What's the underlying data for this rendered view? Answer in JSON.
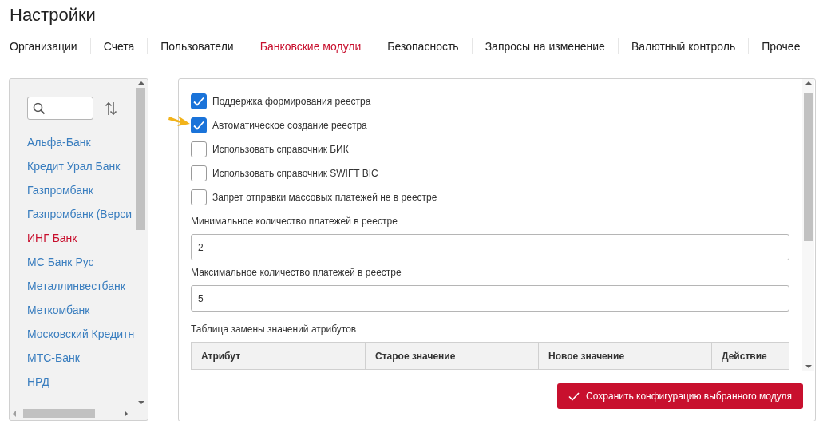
{
  "title": "Настройки",
  "tabs": [
    {
      "label": "Организации",
      "selected": false
    },
    {
      "label": "Счета",
      "selected": false
    },
    {
      "label": "Пользователи",
      "selected": false
    },
    {
      "label": "Банковские модули",
      "selected": true
    },
    {
      "label": "Безопасность",
      "selected": false
    },
    {
      "label": "Запросы на изменение",
      "selected": false
    },
    {
      "label": "Валютный контроль",
      "selected": false
    },
    {
      "label": "Прочее",
      "selected": false
    }
  ],
  "sidebar": {
    "items": [
      {
        "label": "Альфа-Банк",
        "selected": false
      },
      {
        "label": "Кредит Урал Банк",
        "selected": false
      },
      {
        "label": "Газпромбанк",
        "selected": false
      },
      {
        "label": "Газпромбанк (Верси",
        "selected": false
      },
      {
        "label": "ИНГ Банк",
        "selected": true
      },
      {
        "label": "МС Банк Рус",
        "selected": false
      },
      {
        "label": "Металлинвестбанк",
        "selected": false
      },
      {
        "label": "Меткомбанк",
        "selected": false
      },
      {
        "label": "Московский Кредитн",
        "selected": false
      },
      {
        "label": "МТС-Банк",
        "selected": false
      },
      {
        "label": "НРД",
        "selected": false
      }
    ]
  },
  "module": {
    "checkboxes": [
      {
        "label": "Поддержка формирования реестра",
        "checked": true
      },
      {
        "label": "Автоматическое создание реестра",
        "checked": true
      },
      {
        "label": "Использовать справочник БИК",
        "checked": false
      },
      {
        "label": "Использовать справочник SWIFT BIC",
        "checked": false
      },
      {
        "label": "Запрет отправки массовых платежей не в реестре",
        "checked": false
      }
    ],
    "fields": [
      {
        "label": "Минимальное количество платежей в реестре",
        "value": "2"
      },
      {
        "label": "Максимальное количество платежей в реестре",
        "value": "5"
      }
    ],
    "table": {
      "caption": "Таблица замены значений атрибутов",
      "columns": [
        "Атрибут",
        "Старое значение",
        "Новое значение",
        "Действие"
      ]
    },
    "save_button": "Сохранить конфигурацию выбранного модуля"
  }
}
